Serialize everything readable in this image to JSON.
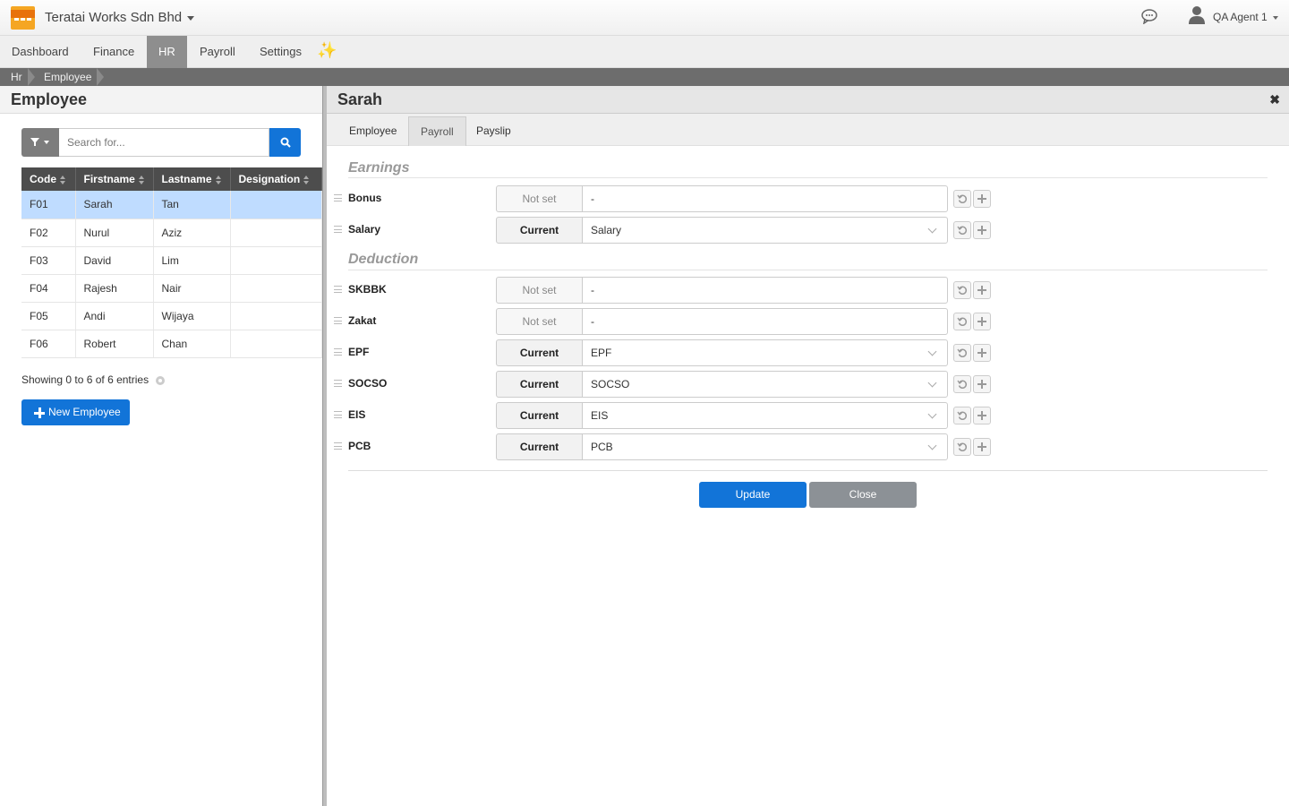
{
  "header": {
    "company": "Teratai Works Sdn Bhd",
    "user": "QA Agent 1"
  },
  "nav": {
    "items": [
      {
        "label": "Dashboard"
      },
      {
        "label": "Finance"
      },
      {
        "label": "HR"
      },
      {
        "label": "Payroll"
      },
      {
        "label": "Settings"
      }
    ],
    "active": "HR"
  },
  "breadcrumb": [
    "Hr",
    "Employee"
  ],
  "left": {
    "title": "Employee",
    "search_placeholder": "Search for...",
    "columns": [
      "Code",
      "Firstname",
      "Lastname",
      "Designation"
    ],
    "rows": [
      {
        "code": "F01",
        "firstname": "Sarah",
        "lastname": "Tan",
        "designation": ""
      },
      {
        "code": "F02",
        "firstname": "Nurul",
        "lastname": "Aziz",
        "designation": ""
      },
      {
        "code": "F03",
        "firstname": "David",
        "lastname": "Lim",
        "designation": ""
      },
      {
        "code": "F04",
        "firstname": "Rajesh",
        "lastname": "Nair",
        "designation": ""
      },
      {
        "code": "F05",
        "firstname": "Andi",
        "lastname": "Wijaya",
        "designation": ""
      },
      {
        "code": "F06",
        "firstname": "Robert",
        "lastname": "Chan",
        "designation": ""
      }
    ],
    "showing": "Showing 0 to 6 of 6 entries",
    "new_button": "New Employee"
  },
  "detail": {
    "title": "Sarah",
    "tabs": [
      "Employee",
      "Payroll",
      "Payslip"
    ],
    "active_tab": "Payroll",
    "earnings_title": "Earnings",
    "earnings": [
      {
        "label": "Bonus",
        "status": "Not set",
        "value": "-"
      },
      {
        "label": "Salary",
        "status": "Current",
        "value": "Salary"
      }
    ],
    "deduction_title": "Deduction",
    "deductions": [
      {
        "label": "SKBBK",
        "status": "Not set",
        "value": "-"
      },
      {
        "label": "Zakat",
        "status": "Not set",
        "value": "-"
      },
      {
        "label": "EPF",
        "status": "Current",
        "value": "EPF"
      },
      {
        "label": "SOCSO",
        "status": "Current",
        "value": "SOCSO"
      },
      {
        "label": "EIS",
        "status": "Current",
        "value": "EIS"
      },
      {
        "label": "PCB",
        "status": "Current",
        "value": "PCB"
      }
    ],
    "update_button": "Update",
    "close_button": "Close"
  },
  "colors": {
    "primary": "#1274d8",
    "selected_row": "#bfdcff",
    "nav_active": "#8e8e8e"
  }
}
